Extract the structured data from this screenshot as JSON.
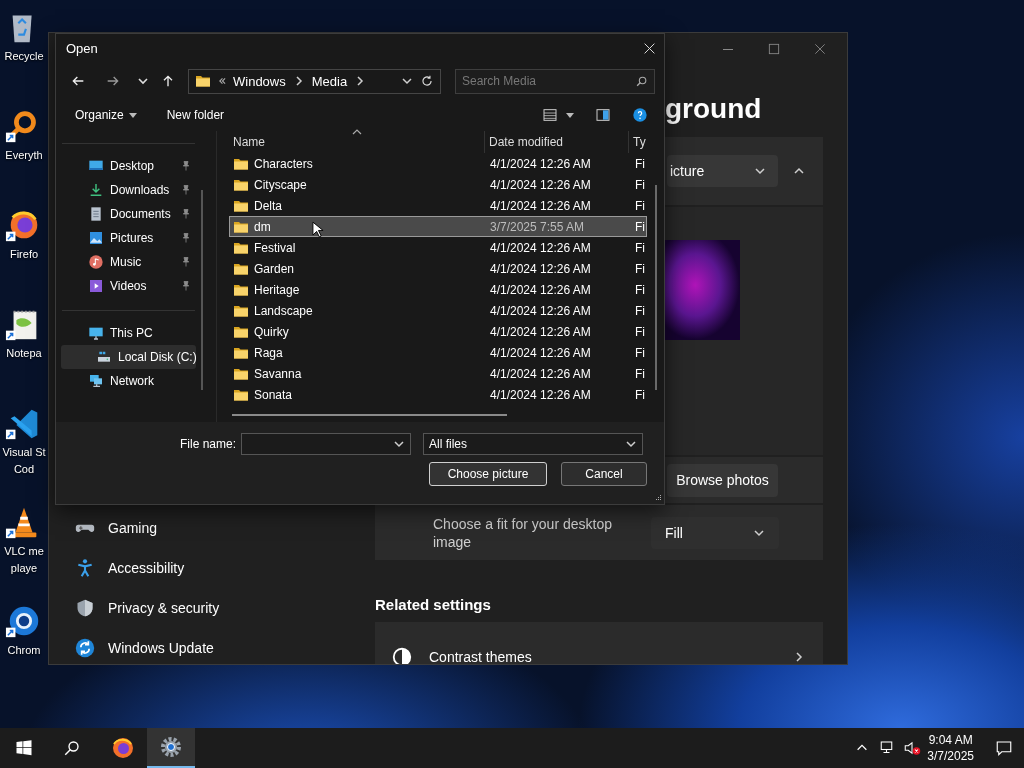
{
  "desktop_icons": [
    {
      "kind": "recycle-bin",
      "lines": [
        "Recycle"
      ]
    },
    {
      "kind": "everything",
      "lines": [
        "Everyth"
      ]
    },
    {
      "kind": "firefox",
      "lines": [
        "Firefo"
      ]
    },
    {
      "kind": "notepad",
      "lines": [
        "Notepa"
      ]
    },
    {
      "kind": "vscode",
      "lines": [
        "Visual St",
        "Cod"
      ]
    },
    {
      "kind": "vlc",
      "lines": [
        "VLC me",
        "playe"
      ]
    },
    {
      "kind": "chrome",
      "lines": [
        "Chrom"
      ]
    }
  ],
  "settings_window": {
    "heading": "ground",
    "background": {
      "value": "icture",
      "expanded": true
    },
    "browse_button": "Browse photos",
    "fit": {
      "label": "Choose a fit for your desktop image",
      "value": "Fill"
    },
    "related_heading": "Related settings",
    "related": [
      {
        "kind": "contrast",
        "title": "Contrast themes"
      }
    ],
    "nav": [
      {
        "kind": "gaming",
        "label": "Gaming"
      },
      {
        "kind": "accessibility",
        "label": "Accessibility"
      },
      {
        "kind": "privacy",
        "label": "Privacy & security"
      },
      {
        "kind": "update",
        "label": "Windows Update"
      }
    ]
  },
  "open_dialog": {
    "title": "Open",
    "path": [
      "Windows",
      "Media"
    ],
    "search_placeholder": "Search Media",
    "organize": "Organize",
    "new_folder": "New folder",
    "quick_access": [
      {
        "kind": "desktop",
        "label": "Desktop",
        "pinned": true
      },
      {
        "kind": "downloads",
        "label": "Downloads",
        "pinned": true
      },
      {
        "kind": "documents",
        "label": "Documents",
        "pinned": true
      },
      {
        "kind": "pictures",
        "label": "Pictures",
        "pinned": true
      },
      {
        "kind": "music",
        "label": "Music",
        "pinned": true
      },
      {
        "kind": "videos",
        "label": "Videos",
        "pinned": true
      }
    ],
    "locations": [
      {
        "kind": "pc",
        "label": "This PC",
        "selected": false,
        "children": [
          {
            "kind": "drive",
            "label": "Local Disk (C:)",
            "selected": true
          }
        ]
      },
      {
        "kind": "network",
        "label": "Network",
        "selected": false
      }
    ],
    "columns": [
      "Name",
      "Date modified",
      "Ty"
    ],
    "rows": [
      {
        "name": "Characters",
        "date": "4/1/2024 12:26 AM",
        "type": "Fi",
        "selected": false
      },
      {
        "name": "Cityscape",
        "date": "4/1/2024 12:26 AM",
        "type": "Fi",
        "selected": false
      },
      {
        "name": "Delta",
        "date": "4/1/2024 12:26 AM",
        "type": "Fi",
        "selected": false
      },
      {
        "name": "dm",
        "date": "3/7/2025 7:55 AM",
        "type": "Fi",
        "selected": true
      },
      {
        "name": "Festival",
        "date": "4/1/2024 12:26 AM",
        "type": "Fi",
        "selected": false
      },
      {
        "name": "Garden",
        "date": "4/1/2024 12:26 AM",
        "type": "Fi",
        "selected": false
      },
      {
        "name": "Heritage",
        "date": "4/1/2024 12:26 AM",
        "type": "Fi",
        "selected": false
      },
      {
        "name": "Landscape",
        "date": "4/1/2024 12:26 AM",
        "type": "Fi",
        "selected": false
      },
      {
        "name": "Quirky",
        "date": "4/1/2024 12:26 AM",
        "type": "Fi",
        "selected": false
      },
      {
        "name": "Raga",
        "date": "4/1/2024 12:26 AM",
        "type": "Fi",
        "selected": false
      },
      {
        "name": "Savanna",
        "date": "4/1/2024 12:26 AM",
        "type": "Fi",
        "selected": false
      },
      {
        "name": "Sonata",
        "date": "4/1/2024 12:26 AM",
        "type": "Fi",
        "selected": false
      }
    ],
    "file_name_label": "File name:",
    "filter": "All files",
    "buttons": [
      {
        "label": "Choose picture",
        "default": true
      },
      {
        "label": "Cancel",
        "default": false
      }
    ]
  },
  "taskbar": {
    "apps": [
      {
        "kind": "firefox",
        "active": false
      },
      {
        "kind": "settings",
        "active": true
      }
    ],
    "time": "9:04 AM",
    "date": "3/7/2025"
  }
}
